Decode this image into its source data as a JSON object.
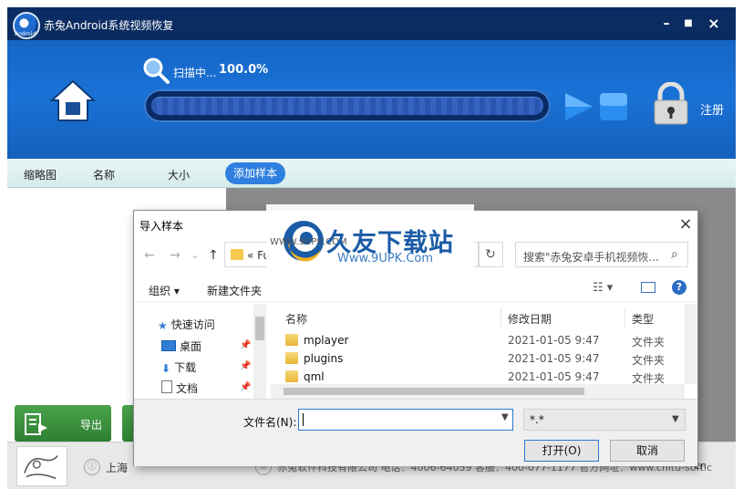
{
  "app": {
    "title": "赤兔Android系统视频恢复",
    "logo_caption": "Android",
    "window_controls": {
      "minimize": "–",
      "maximize": "■",
      "close": "×"
    }
  },
  "scan": {
    "status_text": "扫描中...",
    "percent_text": "100.0%",
    "progress": 1.0
  },
  "register_label": "注册",
  "tabs": {
    "thumbnail": "缩略图",
    "name": "名称",
    "size": "大小",
    "add_sample": "添加样本"
  },
  "export_label": "导出",
  "footer": {
    "company_prefix": "上海",
    "company_suffix": "",
    "rest": "赤兔软件科技有限公司   电话：4006-64059   客服：400-077-1177   官方网址：www.chitu-soft.c",
    "tail": "cn"
  },
  "watermark": {
    "main": "久友下载站",
    "url": "Www.9UPK.Com",
    "small": "WWW.9UPK.COM"
  },
  "dialog": {
    "title": "导入样本",
    "close": "×",
    "nav_back": "←",
    "nav_forward": "→",
    "nav_down": "⌄",
    "nav_up": "↑",
    "address_text": "«  Fu",
    "refresh": "↻",
    "search_placeholder": "搜索\"赤兔安卓手机视频恢...",
    "search_icon": "⌕",
    "organize": "组织 ▾",
    "new_folder": "新建文件夹",
    "view_icon": "☷ ▾",
    "help": "?",
    "nav_items": [
      {
        "label": "快速访问",
        "icon": "star-icon"
      },
      {
        "label": "桌面",
        "icon": "desktop-icon"
      },
      {
        "label": "下载",
        "icon": "download-icon"
      },
      {
        "label": "文档",
        "icon": "document-icon"
      }
    ],
    "columns": {
      "name": "名称",
      "date": "修改日期",
      "type": "类型"
    },
    "files": [
      {
        "name": "mplayer",
        "date": "2021-01-05 9:47",
        "type": "文件夹"
      },
      {
        "name": "plugins",
        "date": "2021-01-05 9:47",
        "type": "文件夹"
      },
      {
        "name": "qml",
        "date": "2021-01-05 9:47",
        "type": "文件夹"
      }
    ],
    "filename_label": "文件名(N):",
    "filename_value": "",
    "filetype_value": "*.*",
    "open_label": "打开(O)",
    "cancel_label": "取消"
  }
}
